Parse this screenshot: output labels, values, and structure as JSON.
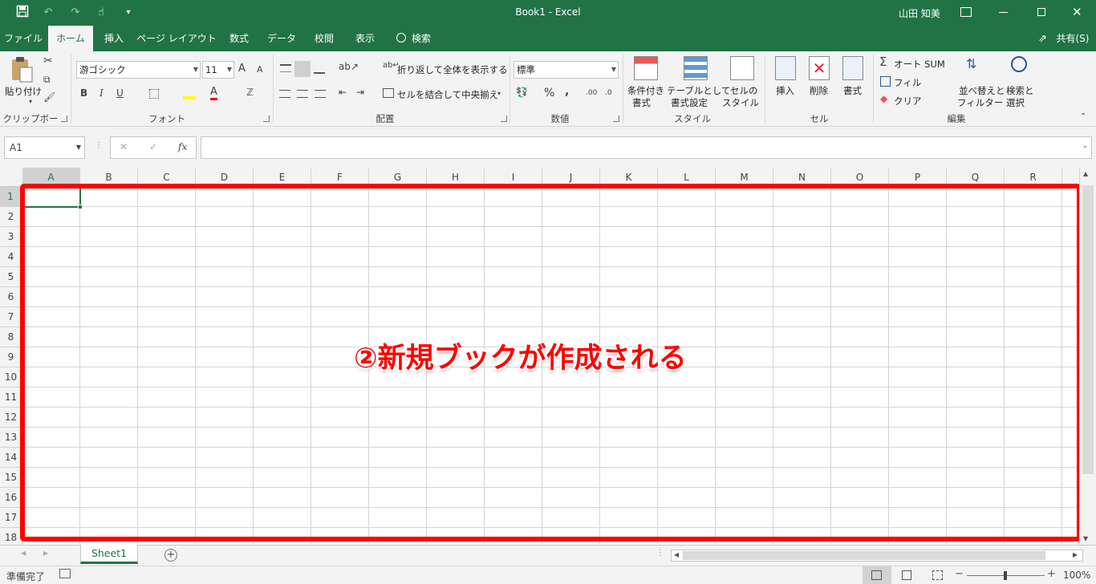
{
  "titlebar": {
    "title": "Book1  -  Excel",
    "user": "山田 知美",
    "qat_more": "▾"
  },
  "tabs": [
    {
      "label": "ファイル"
    },
    {
      "label": "ホーム"
    },
    {
      "label": "挿入"
    },
    {
      "label": "ページ レイアウト"
    },
    {
      "label": "数式"
    },
    {
      "label": "データ"
    },
    {
      "label": "校閲"
    },
    {
      "label": "表示"
    },
    {
      "label": "検索"
    }
  ],
  "share_label": "共有(S)",
  "ribbon": {
    "clipboard": {
      "paste": "貼り付け",
      "label": "クリップボード"
    },
    "font": {
      "name": "游ゴシック",
      "size": "11",
      "bold": "B",
      "italic": "I",
      "underline": "U",
      "label": "フォント",
      "grow": "A",
      "shrink": "A"
    },
    "alignment": {
      "wrap": "折り返して全体を表示する",
      "merge": "セルを結合して中央揃え",
      "label": "配置"
    },
    "number": {
      "format": "標準",
      "percent": "%",
      "comma": ",",
      "inc_decimal": ".00",
      "label": "数値"
    },
    "styles": {
      "conditional_1": "条件付き",
      "conditional_2": "書式",
      "table_1": "テーブルとして",
      "table_2": "書式設定",
      "cell_1": "セルの",
      "cell_2": "スタイル",
      "label": "スタイル"
    },
    "cells": {
      "insert": "挿入",
      "delete": "削除",
      "format": "書式",
      "label": "セル"
    },
    "editing": {
      "autosum": "オート SUM",
      "fill": "フィル",
      "clear": "クリア",
      "sort_1": "並べ替えと",
      "sort_2": "フィルター",
      "find_1": "検索と",
      "find_2": "選択",
      "label": "編集"
    }
  },
  "formula_bar": {
    "name_box": "A1",
    "cancel": "✕",
    "enter": "✓",
    "fx": "fx",
    "formula": ""
  },
  "grid": {
    "columns": [
      "A",
      "B",
      "C",
      "D",
      "E",
      "F",
      "G",
      "H",
      "I",
      "J",
      "K",
      "L",
      "M",
      "N",
      "O",
      "P",
      "Q",
      "R"
    ],
    "rows": [
      "1",
      "2",
      "3",
      "4",
      "5",
      "6",
      "7",
      "8",
      "9",
      "10",
      "11",
      "12",
      "13",
      "14",
      "15",
      "16",
      "17",
      "18"
    ],
    "active_cell": "A1"
  },
  "annotation": {
    "text": "②新規ブックが作成される",
    "color": "#ff0000"
  },
  "sheet_tabs": [
    {
      "label": "Sheet1"
    }
  ],
  "status": {
    "ready": "準備完了",
    "zoom": "100%"
  },
  "colors": {
    "excel_green": "#217346",
    "ribbon_bg": "#f3f3f3",
    "annotation_red": "#ff0000"
  }
}
